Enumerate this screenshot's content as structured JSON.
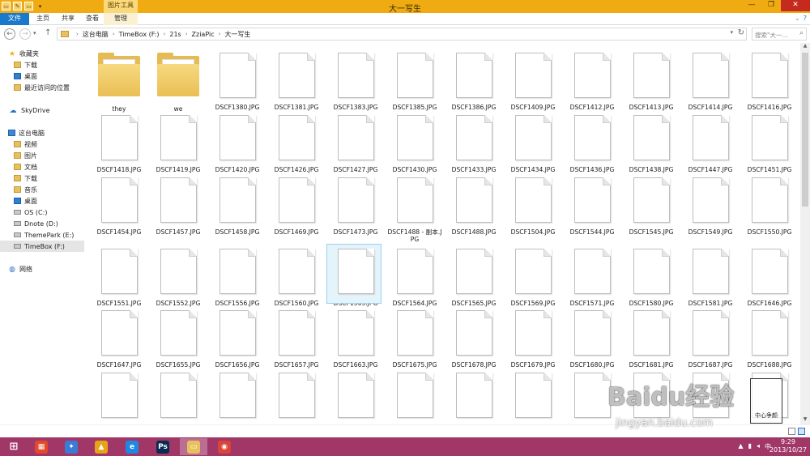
{
  "window": {
    "title": "大一写生",
    "context_tab": "图片工具",
    "controls": [
      "—",
      "❐",
      "✕"
    ]
  },
  "ribbon": {
    "tabs": [
      "文件",
      "主页",
      "共享",
      "查看",
      "管理"
    ]
  },
  "address": {
    "crumbs": [
      "这台电脑",
      "TimeBox (F:)",
      "21s",
      "ZziaPic",
      "大一写生"
    ],
    "search_placeholder": "搜索\"大一...",
    "sep": "›"
  },
  "nav": {
    "favorites": {
      "label": "收藏夹",
      "items": [
        "下载",
        "桌面",
        "最近访问的位置"
      ]
    },
    "skydrive": "SkyDrive",
    "thispc": {
      "label": "这台电脑",
      "items": [
        "视频",
        "图片",
        "文档",
        "下载",
        "音乐",
        "桌面",
        "OS (C:)",
        "Dnote (D:)",
        "ThemePark (E:)",
        "TimeBox (F:)"
      ]
    },
    "network": "网络"
  },
  "files": [
    {
      "name": "they",
      "type": "folder"
    },
    {
      "name": "we",
      "type": "folder"
    },
    {
      "name": "DSCF1380.JPG",
      "type": "doc"
    },
    {
      "name": "DSCF1381.JPG",
      "type": "doc"
    },
    {
      "name": "DSCF1383.JPG",
      "type": "doc"
    },
    {
      "name": "DSCF1385.JPG",
      "type": "doc"
    },
    {
      "name": "DSCF1386.JPG",
      "type": "doc"
    },
    {
      "name": "DSCF1409.JPG",
      "type": "doc"
    },
    {
      "name": "DSCF1412.JPG",
      "type": "doc"
    },
    {
      "name": "DSCF1413.JPG",
      "type": "doc"
    },
    {
      "name": "DSCF1414.JPG",
      "type": "doc"
    },
    {
      "name": "DSCF1416.JPG",
      "type": "doc"
    },
    {
      "name": "DSCF1418.JPG",
      "type": "doc"
    },
    {
      "name": "DSCF1419.JPG",
      "type": "doc"
    },
    {
      "name": "DSCF1420.JPG",
      "type": "doc"
    },
    {
      "name": "DSCF1426.JPG",
      "type": "doc"
    },
    {
      "name": "DSCF1427.JPG",
      "type": "doc"
    },
    {
      "name": "DSCF1430.JPG",
      "type": "doc"
    },
    {
      "name": "DSCF1433.JPG",
      "type": "doc"
    },
    {
      "name": "DSCF1434.JPG",
      "type": "doc"
    },
    {
      "name": "DSCF1436.JPG",
      "type": "doc"
    },
    {
      "name": "DSCF1438.JPG",
      "type": "doc"
    },
    {
      "name": "DSCF1447.JPG",
      "type": "doc"
    },
    {
      "name": "DSCF1451.JPG",
      "type": "doc"
    },
    {
      "name": "DSCF1454.JPG",
      "type": "doc"
    },
    {
      "name": "DSCF1457.JPG",
      "type": "doc"
    },
    {
      "name": "DSCF1458.JPG",
      "type": "doc"
    },
    {
      "name": "DSCF1469.JPG",
      "type": "doc"
    },
    {
      "name": "DSCF1473.JPG",
      "type": "doc"
    },
    {
      "name": "DSCF1488 - 副本.JPG",
      "type": "doc"
    },
    {
      "name": "DSCF1488.JPG",
      "type": "doc"
    },
    {
      "name": "DSCF1504.JPG",
      "type": "doc"
    },
    {
      "name": "DSCF1544.JPG",
      "type": "doc"
    },
    {
      "name": "DSCF1545.JPG",
      "type": "doc"
    },
    {
      "name": "DSCF1549.JPG",
      "type": "doc"
    },
    {
      "name": "DSCF1550.JPG",
      "type": "doc"
    },
    {
      "name": "DSCF1551.JPG",
      "type": "doc"
    },
    {
      "name": "DSCF1552.JPG",
      "type": "doc"
    },
    {
      "name": "DSCF1556.JPG",
      "type": "doc"
    },
    {
      "name": "DSCF1560.JPG",
      "type": "doc"
    },
    {
      "name": "DSCF1563.JPG",
      "type": "doc",
      "selected": true
    },
    {
      "name": "DSCF1564.JPG",
      "type": "doc"
    },
    {
      "name": "DSCF1565.JPG",
      "type": "doc"
    },
    {
      "name": "DSCF1569.JPG",
      "type": "doc"
    },
    {
      "name": "DSCF1571.JPG",
      "type": "doc"
    },
    {
      "name": "DSCF1580.JPG",
      "type": "doc"
    },
    {
      "name": "DSCF1581.JPG",
      "type": "doc"
    },
    {
      "name": "DSCF1646.JPG",
      "type": "doc"
    },
    {
      "name": "DSCF1647.JPG",
      "type": "doc"
    },
    {
      "name": "DSCF1655.JPG",
      "type": "doc"
    },
    {
      "name": "DSCF1656.JPG",
      "type": "doc"
    },
    {
      "name": "DSCF1657.JPG",
      "type": "doc"
    },
    {
      "name": "DSCF1663.JPG",
      "type": "doc"
    },
    {
      "name": "DSCF1675.JPG",
      "type": "doc"
    },
    {
      "name": "DSCF1678.JPG",
      "type": "doc"
    },
    {
      "name": "DSCF1679.JPG",
      "type": "doc"
    },
    {
      "name": "DSCF1680.JPG",
      "type": "doc"
    },
    {
      "name": "DSCF1681.JPG",
      "type": "doc"
    },
    {
      "name": "DSCF1687.JPG",
      "type": "doc"
    },
    {
      "name": "DSCF1688.JPG",
      "type": "doc"
    },
    {
      "name": "",
      "type": "doc"
    },
    {
      "name": "",
      "type": "doc"
    },
    {
      "name": "",
      "type": "doc"
    },
    {
      "name": "",
      "type": "doc"
    },
    {
      "name": "",
      "type": "doc"
    },
    {
      "name": "",
      "type": "doc"
    },
    {
      "name": "",
      "type": "doc"
    },
    {
      "name": "",
      "type": "doc"
    },
    {
      "name": "",
      "type": "doc"
    },
    {
      "name": "",
      "type": "doc"
    },
    {
      "name": "",
      "type": "doc"
    },
    {
      "name": "",
      "type": "doc"
    }
  ],
  "taskbar": {
    "apps": [
      {
        "name": "start",
        "glyph": "⊞",
        "color": "transparent"
      },
      {
        "name": "store",
        "glyph": "▦",
        "color": "#e24a2a"
      },
      {
        "name": "apps",
        "glyph": "✦",
        "color": "#3a7bd5"
      },
      {
        "name": "aimp",
        "glyph": "▲",
        "color": "#e8a317"
      },
      {
        "name": "ie",
        "glyph": "e",
        "color": "#1e88e5"
      },
      {
        "name": "photoshop",
        "glyph": "Ps",
        "color": "#0a2a52"
      },
      {
        "name": "explorer",
        "glyph": "▭",
        "color": "#e8c15e",
        "active": true
      },
      {
        "name": "chrome",
        "glyph": "◉",
        "color": "#db4437"
      }
    ],
    "tray": [
      "▲",
      "▮",
      "◂",
      "中"
    ],
    "time": "9:29",
    "date": "2013/10/27"
  },
  "watermark": {
    "text": "Baidu经验",
    "url": "jingyan.baidu.com",
    "seal": "中心争颜"
  }
}
